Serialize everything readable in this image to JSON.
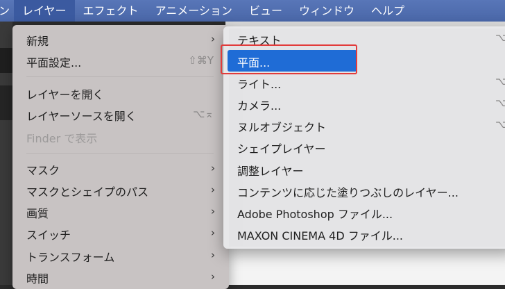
{
  "menubar": {
    "items": [
      {
        "label": "ン"
      },
      {
        "label": "レイヤー"
      },
      {
        "label": "エフェクト"
      },
      {
        "label": "アニメーション"
      },
      {
        "label": "ビュー"
      },
      {
        "label": "ウィンドウ"
      },
      {
        "label": "ヘルプ"
      }
    ]
  },
  "layer_menu": {
    "items": [
      {
        "label": "新規",
        "shortcut": "",
        "submenu": true
      },
      {
        "label": "平面設定...",
        "shortcut": "⇧⌘Y"
      },
      {
        "label": "レイヤーを開く",
        "shortcut": ""
      },
      {
        "label": "レイヤーソースを開く",
        "shortcut": "⌥⌅"
      },
      {
        "label": "Finder で表示",
        "shortcut": "",
        "disabled": true
      },
      {
        "label": "マスク",
        "submenu": true
      },
      {
        "label": "マスクとシェイプのパス",
        "submenu": true
      },
      {
        "label": "画質",
        "submenu": true
      },
      {
        "label": "スイッチ",
        "submenu": true
      },
      {
        "label": "トランスフォーム",
        "submenu": true
      },
      {
        "label": "時間",
        "submenu": true
      }
    ],
    "arrow": "›"
  },
  "new_submenu": {
    "items": [
      {
        "label": "テキスト",
        "shortcut": "⌥"
      },
      {
        "label": "平面...",
        "shortcut": "⌘",
        "selected": true
      },
      {
        "label": "ライト...",
        "shortcut": "⌥"
      },
      {
        "label": "カメラ...",
        "shortcut": "⌥"
      },
      {
        "label": "ヌルオブジェクト",
        "shortcut": "⌥"
      },
      {
        "label": "シェイプレイヤー",
        "shortcut": ""
      },
      {
        "label": "調整レイヤー",
        "shortcut": ""
      },
      {
        "label": "コンテンツに応じた塗りつぶしのレイヤー...",
        "shortcut": ""
      },
      {
        "label": "Adobe Photoshop ファイル...",
        "shortcut": ""
      },
      {
        "label": "MAXON CINEMA 4D ファイル...",
        "shortcut": ""
      }
    ]
  },
  "colors": {
    "menubar": "#4a67a8",
    "selection": "#1f6cd6",
    "callout": "#e23b3b"
  }
}
